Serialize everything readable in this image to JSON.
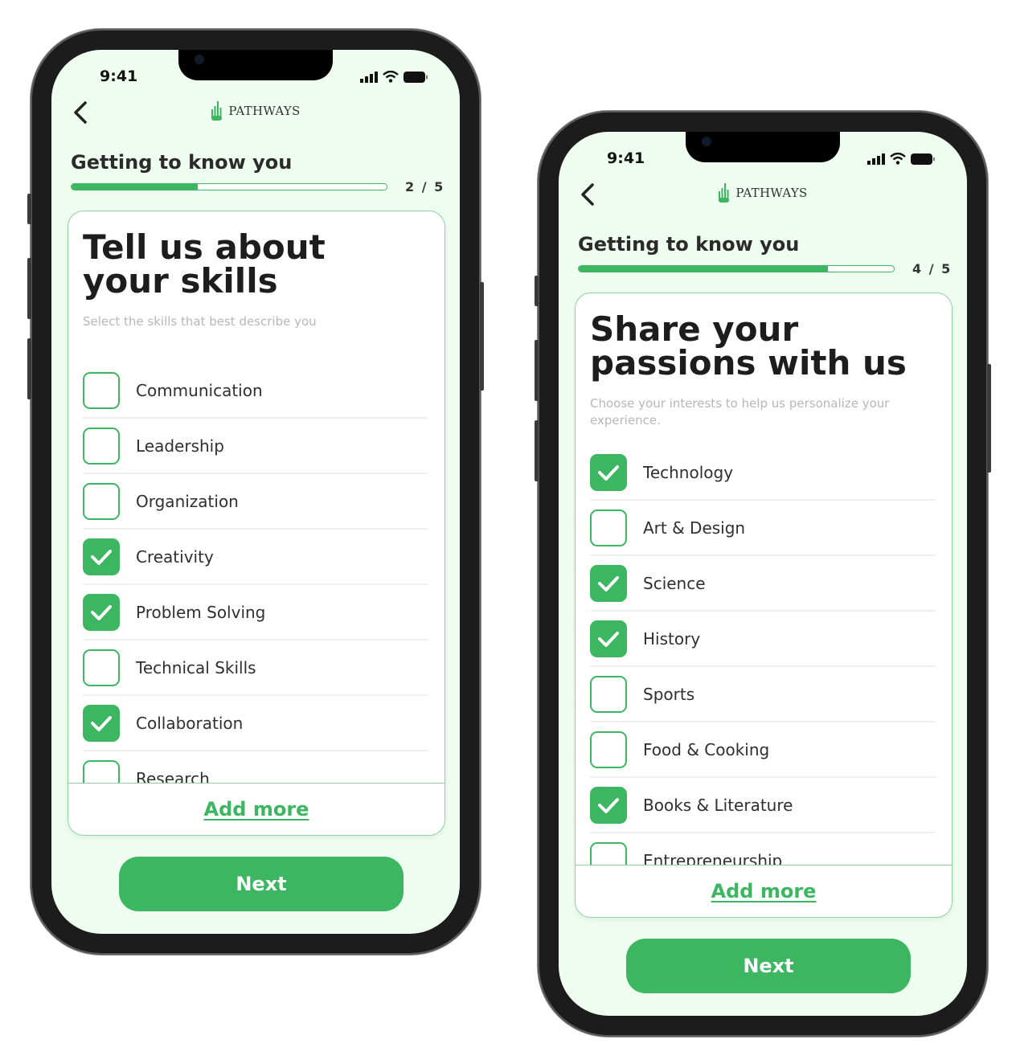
{
  "colors": {
    "accent": "#3cb660",
    "background": "#eefdf0",
    "text": "#2b2b2b"
  },
  "phones": [
    {
      "status": {
        "time": "9:41",
        "icons": [
          "cellular-signal-icon",
          "wifi-icon",
          "battery-icon"
        ]
      },
      "brand": "PATHWAYS",
      "section_title": "Getting to know you",
      "progress": {
        "step": 2,
        "total": 5,
        "label": "2 / 5",
        "fraction": 0.4
      },
      "heading": "Tell us about your skills",
      "subtitle": "Select the skills that best describe you",
      "items": [
        {
          "label": "Communication",
          "checked": false
        },
        {
          "label": "Leadership",
          "checked": false
        },
        {
          "label": "Organization",
          "checked": false
        },
        {
          "label": "Creativity",
          "checked": true
        },
        {
          "label": "Problem Solving",
          "checked": true
        },
        {
          "label": "Technical Skills",
          "checked": false
        },
        {
          "label": "Collaboration",
          "checked": true
        },
        {
          "label": "Research",
          "checked": false
        }
      ],
      "add_more": "Add more",
      "next": "Next"
    },
    {
      "status": {
        "time": "9:41",
        "icons": [
          "cellular-signal-icon",
          "wifi-icon",
          "battery-icon"
        ]
      },
      "brand": "PATHWAYS",
      "section_title": "Getting to know you",
      "progress": {
        "step": 4,
        "total": 5,
        "label": "4 / 5",
        "fraction": 0.79
      },
      "heading": "Share your passions with us",
      "subtitle": "Choose your interests to help us personalize your experience.",
      "items": [
        {
          "label": "Technology",
          "checked": true
        },
        {
          "label": "Art & Design",
          "checked": false
        },
        {
          "label": "Science",
          "checked": true
        },
        {
          "label": "History",
          "checked": true
        },
        {
          "label": "Sports",
          "checked": false
        },
        {
          "label": "Food & Cooking",
          "checked": false
        },
        {
          "label": "Books & Literature",
          "checked": true
        },
        {
          "label": "Entrepreneurship",
          "checked": false
        }
      ],
      "add_more": "Add more",
      "next": "Next"
    }
  ]
}
